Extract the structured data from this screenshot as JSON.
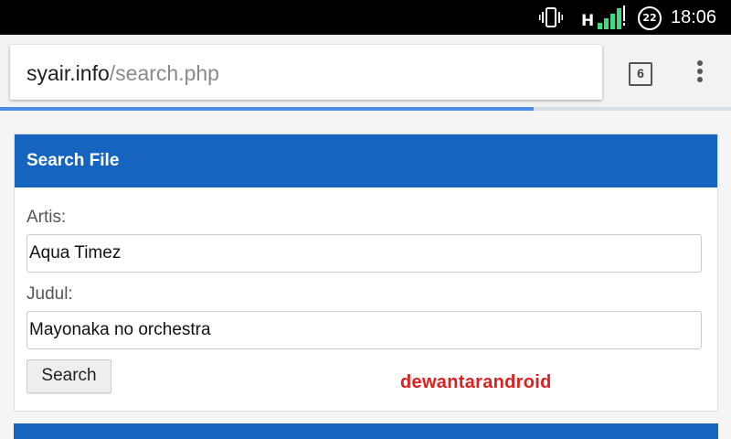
{
  "status_bar": {
    "network_type": "H",
    "battery_level": "22",
    "time": "18:06",
    "icons": [
      "vibrate-icon",
      "signal-icon",
      "battery-icon"
    ]
  },
  "browser": {
    "url_host": "syair.info",
    "url_path": "/search.php",
    "tab_count": "6",
    "load_progress_fraction": 0.73,
    "colors": {
      "progress": "#4a8ae8"
    }
  },
  "form": {
    "title": "Search File",
    "artist_label": "Artis:",
    "artist_value": "Aqua Timez",
    "title_label": "Judul:",
    "title_value": "Mayonaka no orchestra",
    "submit_label": "Search",
    "colors": {
      "heading": "#1565c0"
    }
  },
  "watermark": {
    "text": "dewantarandroid",
    "color": "#e01e1e"
  }
}
